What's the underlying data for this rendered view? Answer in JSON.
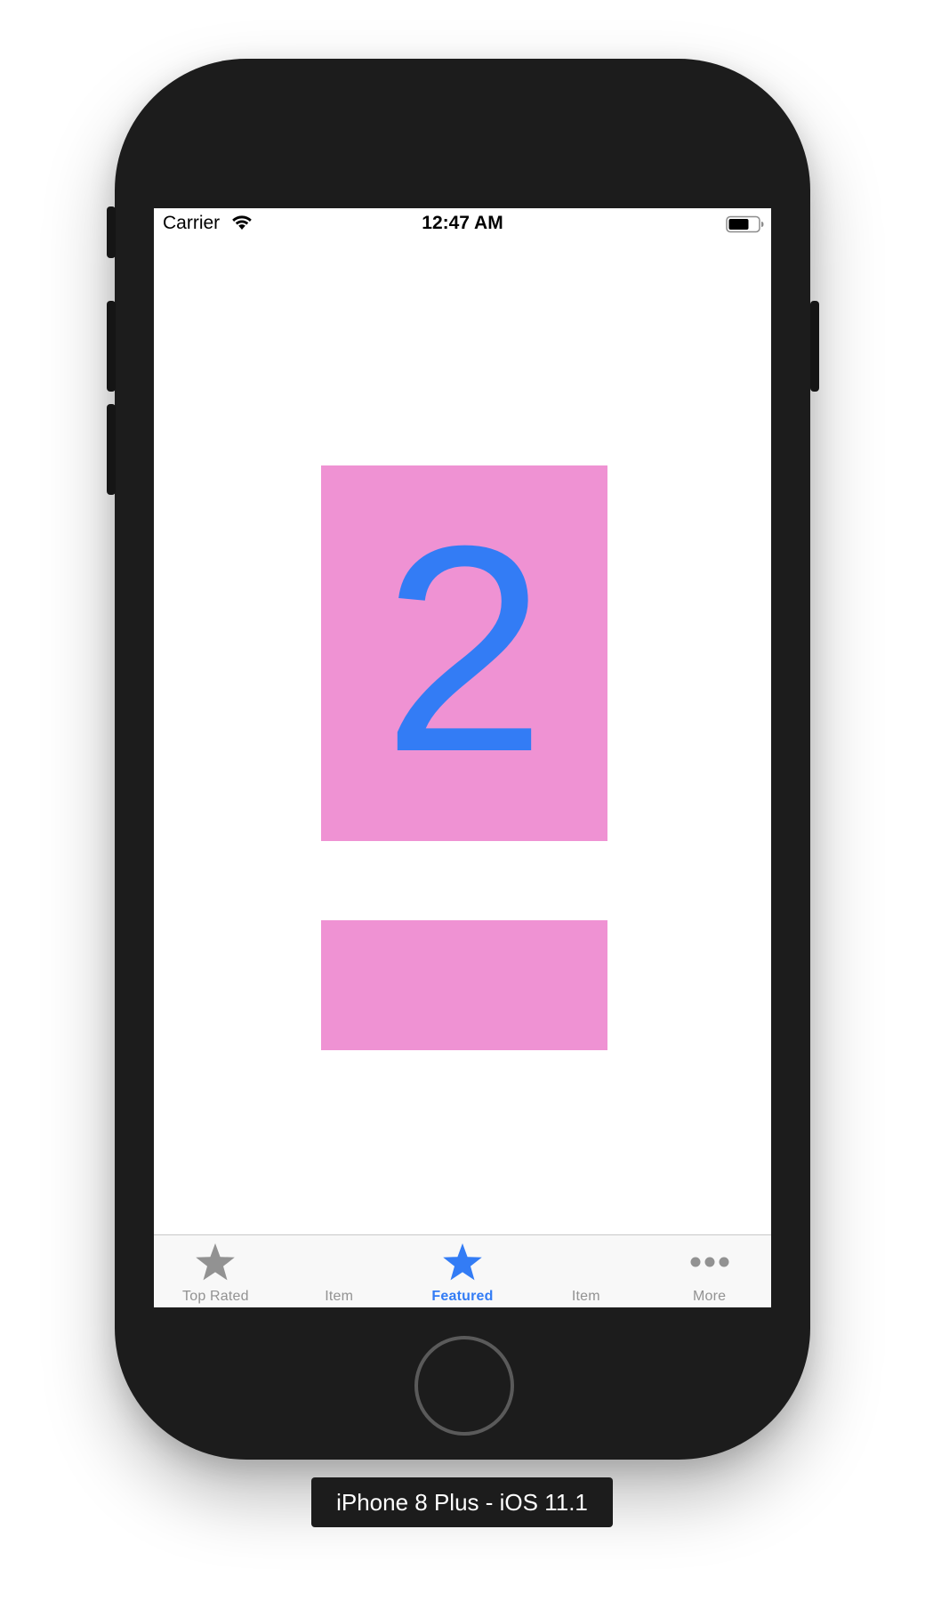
{
  "status_bar": {
    "carrier": "Carrier",
    "time": "12:47 AM",
    "wifi_icon": "wifi-icon",
    "battery_icon": "battery-icon"
  },
  "content": {
    "page_number": "2",
    "card_color": "#ef92d3",
    "digit_color": "#337cf5"
  },
  "tab_bar": {
    "tabs": [
      {
        "label": "Top Rated",
        "icon": "star-icon",
        "active": false
      },
      {
        "label": "Item",
        "icon": "",
        "active": false
      },
      {
        "label": "Featured",
        "icon": "star-icon",
        "active": true
      },
      {
        "label": "Item",
        "icon": "",
        "active": false
      },
      {
        "label": "More",
        "icon": "more-icon",
        "active": false
      }
    ],
    "active_color": "#337cf5",
    "inactive_color": "#929292"
  },
  "simulator": {
    "device_title": "iPhone 8 Plus - iOS 11.1"
  }
}
